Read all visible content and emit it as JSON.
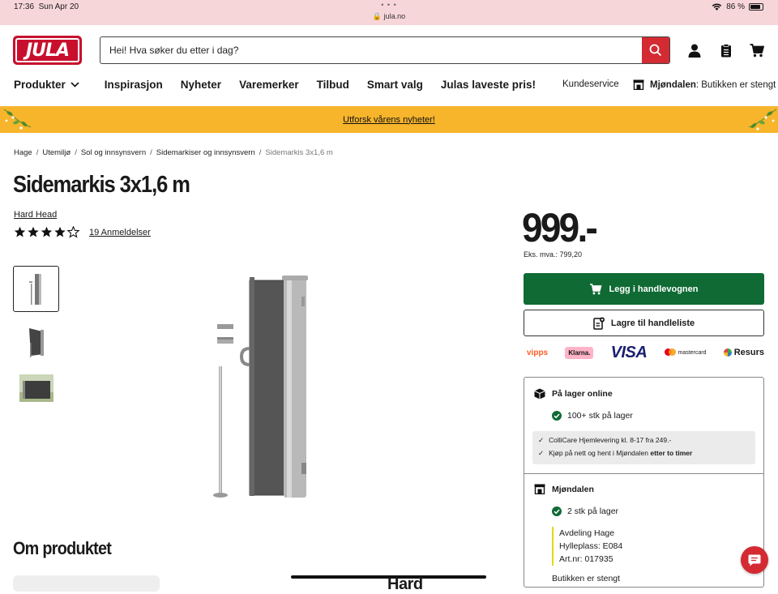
{
  "status_bar": {
    "time": "17:36",
    "date": "Sun Apr 20",
    "url": "jula.no",
    "battery": "86 %"
  },
  "header": {
    "logo": "JULA",
    "search_placeholder": "Hei! Hva søker du etter i dag?",
    "nav": [
      "Produkter",
      "Inspirasjon",
      "Nyheter",
      "Varemerker",
      "Tilbud",
      "Smart valg",
      "Julas laveste pris!"
    ],
    "customer_service": "Kundeservice",
    "store_name": "Mjøndalen",
    "store_status": ": Butikken er stengt"
  },
  "banner": {
    "text": "Utforsk vårens nyheter!"
  },
  "breadcrumbs": [
    "Hage",
    "Utemiljø",
    "Sol og innsynsvern",
    "Sidemarkiser og innsynsvern",
    "Sidemarkis 3x1,6 m"
  ],
  "product": {
    "title": "Sidemarkis 3x1,6 m",
    "brand": "Hard Head",
    "rating": 4.5,
    "reviews": "19 Anmeldelser",
    "price": "999.-",
    "price_ex_vat": "Eks. mva.: 799,20",
    "add_to_cart": "Legg i handlevognen",
    "save_list": "Lagre til handleliste",
    "about_heading": "Om produktet",
    "about_preview": "Hard"
  },
  "payments": {
    "vipps": "vipps",
    "klarna": "Klarna.",
    "visa": "VISA",
    "mastercard": "mastercard",
    "resurs": "Resurs"
  },
  "stock": {
    "online_title": "På lager online",
    "online_qty": "100+ stk på lager",
    "delivery_1": "ColliCare Hjemlevering kl. 8-17 fra 249.-",
    "delivery_2_prefix": "Kjøp på nett og hent i Mjøndalen ",
    "delivery_2_bold": "etter to timer",
    "store_title": "Mjøndalen",
    "store_qty": "2 stk på lager",
    "department": "Avdeling Hage",
    "shelf": "Hylleplass: E084",
    "artnr": "Art.nr: 017935",
    "store_closed": "Butikken er stengt"
  },
  "colors": {
    "brand_red": "#d42a32",
    "banner": "#f7b52c",
    "cart_green": "#0f6a34",
    "status_bg": "#f7d6d9"
  }
}
